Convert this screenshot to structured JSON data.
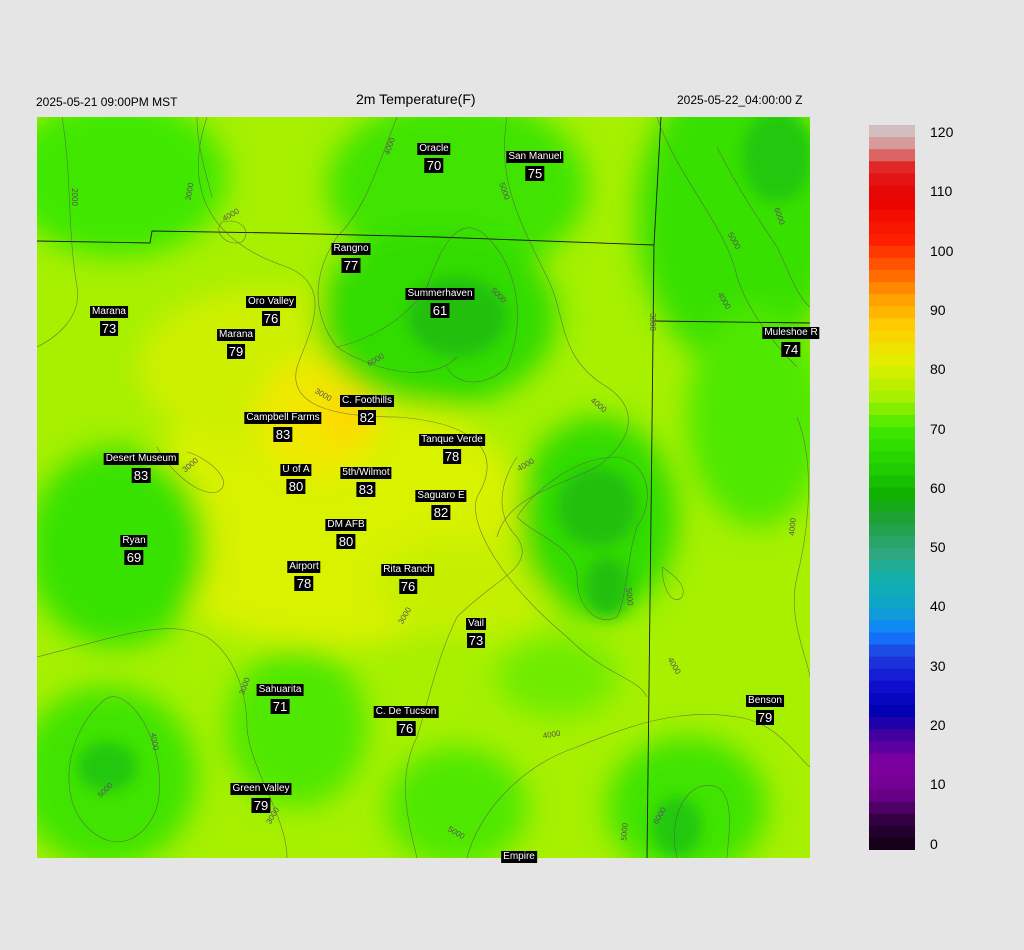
{
  "header": {
    "local_time": "2025-05-21 09:00PM MST",
    "title": "2m Temperature(F)",
    "utc_time": "2025-05-22_04:00:00 Z"
  },
  "stations": [
    {
      "name": "Oracle",
      "value": "70"
    },
    {
      "name": "San Manuel",
      "value": "75"
    },
    {
      "name": "Rangno",
      "value": "77"
    },
    {
      "name": "Summerhaven",
      "value": "61"
    },
    {
      "name": "Marana",
      "value": "73"
    },
    {
      "name": "Oro Valley",
      "value": "76"
    },
    {
      "name": "Marana",
      "value": "79"
    },
    {
      "name": "Muleshoe R",
      "value": "74"
    },
    {
      "name": "C. Foothills",
      "value": "82"
    },
    {
      "name": "Campbell Farms",
      "value": "83"
    },
    {
      "name": "Tanque Verde",
      "value": "78"
    },
    {
      "name": "Desert Museum",
      "value": "83"
    },
    {
      "name": "U of A",
      "value": "80"
    },
    {
      "name": "5th/Wilmot",
      "value": "83"
    },
    {
      "name": "Saguaro E",
      "value": "82"
    },
    {
      "name": "DM AFB",
      "value": "80"
    },
    {
      "name": "Ryan",
      "value": "69"
    },
    {
      "name": "Airport",
      "value": "78"
    },
    {
      "name": "Rita Ranch",
      "value": "76"
    },
    {
      "name": "Vail",
      "value": "73"
    },
    {
      "name": "Sahuarita",
      "value": "71"
    },
    {
      "name": "C. De Tucson",
      "value": "76"
    },
    {
      "name": "Benson",
      "value": "79"
    },
    {
      "name": "Green Valley",
      "value": "79"
    },
    {
      "name": "Empire",
      "value": ""
    }
  ],
  "contour_labels": [
    "2000",
    "3000",
    "4000",
    "5000",
    "6000"
  ],
  "colorbar": {
    "ticks": [
      "120",
      "110",
      "100",
      "90",
      "80",
      "70",
      "60",
      "50",
      "40",
      "30",
      "20",
      "10",
      "0"
    ]
  }
}
